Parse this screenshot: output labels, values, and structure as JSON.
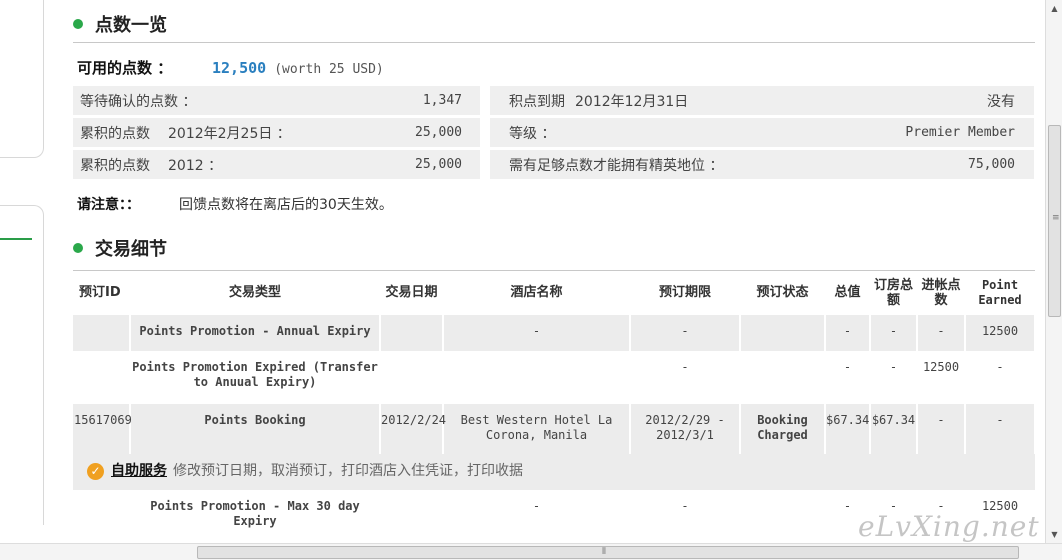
{
  "points_section": {
    "title": "点数一览",
    "available_label": "可用的点数 ：",
    "available_value": "12,500",
    "available_worth": "(worth 25 USD)",
    "pending_label": "等待确认的点数 ：",
    "pending_value": "1,347",
    "expiry_label": "积点到期",
    "expiry_date": "2012年12月31日",
    "expiry_value": "没有",
    "accum_date_label": "累积的点数",
    "accum_date": "2012年2月25日 ：",
    "accum_date_value": "25,000",
    "tier_label": "等级 ：",
    "tier_value": "Premier Member",
    "accum_year_label": "累积的点数",
    "accum_year": "2012 ：",
    "accum_year_value": "25,000",
    "elite_label": "需有足够点数才能拥有精英地位 ：",
    "elite_value": "75,000",
    "note_label": "请注意：：",
    "note_text": "回馈点数将在离店后的30天生效。"
  },
  "tx_section": {
    "title": "交易细节",
    "headers": {
      "id": "预订ID",
      "type": "交易类型",
      "date": "交易日期",
      "hotel": "酒店名称",
      "stay": "预订期限",
      "status": "预订状态",
      "total": "总值",
      "room_total": "订房总额",
      "posted": "进帐点数",
      "earned": "Point Earned"
    },
    "rows": [
      {
        "id": "",
        "type": "Points Promotion - Annual Expiry",
        "date": "",
        "hotel": "-",
        "stay": "-",
        "status": "",
        "total": "-",
        "room_total": "-",
        "posted": "-",
        "earned": "12500"
      },
      {
        "id": "",
        "type": "Points Promotion Expired (Transfer to Anuual Expiry)",
        "date": "",
        "hotel": "",
        "stay": "-",
        "status": "",
        "total": "-",
        "room_total": "-",
        "posted": "12500",
        "earned": "-"
      },
      {
        "id": "15617069",
        "type": "Points Booking",
        "date": "2012/2/24",
        "hotel": "Best Western Hotel La Corona, Manila",
        "stay": "2012/2/29 - 2012/3/1",
        "status": "Booking Charged",
        "total": "$67.34",
        "room_total": "$67.34",
        "posted": "-",
        "earned": "-"
      },
      {
        "id": "",
        "type": "Points Promotion - Max 30 day Expiry",
        "date": "",
        "hotel": "-",
        "stay": "-",
        "status": "",
        "total": "-",
        "room_total": "-",
        "posted": "-",
        "earned": "12500"
      }
    ],
    "self_service": {
      "link": "自助服务",
      "desc": "修改预订日期，取消预订，打印酒店入住凭证，打印收据"
    }
  },
  "watermark": "eLvXing.net",
  "colors": {
    "accent_green": "#2aa84a",
    "points_blue": "#2a7fbf",
    "check_orange": "#f0a020"
  }
}
